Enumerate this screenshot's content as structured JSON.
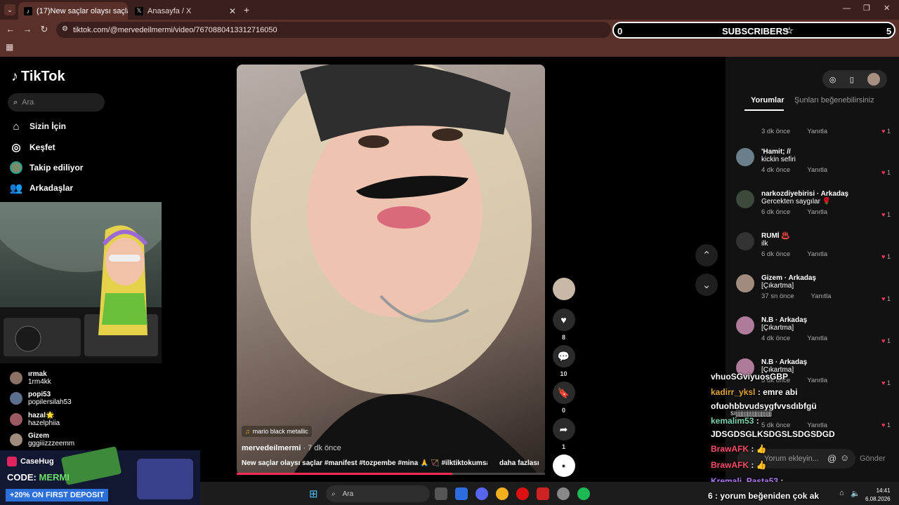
{
  "browser": {
    "tabs": [
      {
        "label": "(17)New saçlar olaysı saçlar #m",
        "active": true
      },
      {
        "label": "Anasayfa / X",
        "active": false
      }
    ],
    "url": "tiktok.com/@mervedeilmermi/video/7670880413312716050",
    "subscribers_widget": {
      "left_count": "0",
      "label": "SUBSCRIBERS",
      "right_count": "5"
    }
  },
  "tiktok": {
    "logo": "TikTok",
    "search_placeholder": "Ara",
    "nav": [
      "Sizin İçin",
      "Keşfet",
      "Takip ediliyor",
      "Arkadaşlar"
    ],
    "following": [
      {
        "name": "ırmak",
        "handle": "1rm4kk"
      },
      {
        "name": "popi53",
        "handle": "popilersilah53"
      },
      {
        "name": "hazal🌟",
        "handle": "hazelphiia"
      },
      {
        "name": "Gizem",
        "handle": "gggiiizzzeemm"
      }
    ],
    "video": {
      "music": "mario black metallic",
      "author": "mervedeilmermi",
      "time": "· 7 dk önce",
      "caption": "New saçlar olaysı saçlar #manifest #tozpembe #mina 🙏 🏹 #ilktiktokumsa...",
      "more": "daha fazlası"
    },
    "actions": {
      "likes": "8",
      "comments": "10",
      "saves": "0",
      "shares": "1"
    },
    "panel_tabs": [
      "Yorumlar",
      "Şunları beğenebilirsiniz"
    ],
    "comments": [
      {
        "name": "",
        "text": "",
        "time": "3 dk önce",
        "reply": "Yanıtla",
        "likes": "1"
      },
      {
        "name": "'Hamit; //",
        "text": "kickin sefiri",
        "time": "4 dk önce",
        "reply": "Yanıtla",
        "likes": "1"
      },
      {
        "name": "narkozdiyebirisi · Arkadaş",
        "text": "Gercekten saygılar 🌹",
        "time": "6 dk önce",
        "reply": "Yanıtla",
        "likes": "1"
      },
      {
        "name": "RUMİ ♨️",
        "text": "ilk",
        "time": "6 dk önce",
        "reply": "Yanıtla",
        "likes": "1"
      },
      {
        "name": "Gizem · Arkadaş",
        "text": "[Çıkartma]",
        "time": "37 sn önce",
        "reply": "Yanıtla",
        "likes": "1"
      },
      {
        "name": "N.B · Arkadaş",
        "text": "[Çıkartma]",
        "time": "4 dk önce",
        "reply": "Yanıtla",
        "likes": "1"
      },
      {
        "name": "N.B · Arkadaş",
        "text": "[Çıkartma]",
        "time": "5 dk önce",
        "reply": "Yanıtla",
        "likes": "1"
      },
      {
        "name": "",
        "text": "",
        "time": "5 dk önce",
        "reply": "Yanıtla",
        "likes": "1"
      }
    ],
    "comment_placeholder": "Yorum ekleyin...",
    "send": "Gönder"
  },
  "casehug": {
    "brand": "CaseHug",
    "code_label": "CODE:",
    "code": "MERMI",
    "offer": "+20% ON FIRST DEPOSIT"
  },
  "stream_chat": [
    {
      "user": "",
      "msg": "vhuoSGviyuosGBP",
      "color": "#ffffff"
    },
    {
      "user": "kadirr_yksl",
      "msg": ": emre abi",
      "color": "#e0a63a"
    },
    {
      "user": "",
      "msg": "ofuohbbvudsygfvvsdıbfgü",
      "color": "#ffffff"
    },
    {
      "user": "",
      "msg": "sıjjjjjjjjjjjjjjjjjjjjjjj",
      "color": "#ffffff"
    },
    {
      "user": "kemalim53",
      "msg": ":",
      "color": "#7fd1b0"
    },
    {
      "user": "",
      "msg": "JDSGDSGLKSDGSLSDGSDGD",
      "color": "#ffffff"
    },
    {
      "user": "BrawAFK",
      "msg": ": 👍",
      "color": "#ff4f6b"
    },
    {
      "user": "BrawAFK",
      "msg": ": 👍",
      "color": "#ff4f6b"
    },
    {
      "user": "Kremali_Pasta53",
      "msg": ":",
      "color": "#b47cff"
    },
    {
      "user": "",
      "msg": "6 : yorum beğeniden çok ak",
      "color": "#ffffff"
    }
  ],
  "taskbar": {
    "search": "Ara",
    "time": "14:41",
    "date": "6.08.2026"
  },
  "colors": {
    "chrome": "#5a302b",
    "chrome_dark": "#3b1f1c",
    "tiktok_red": "#fe2c55"
  }
}
